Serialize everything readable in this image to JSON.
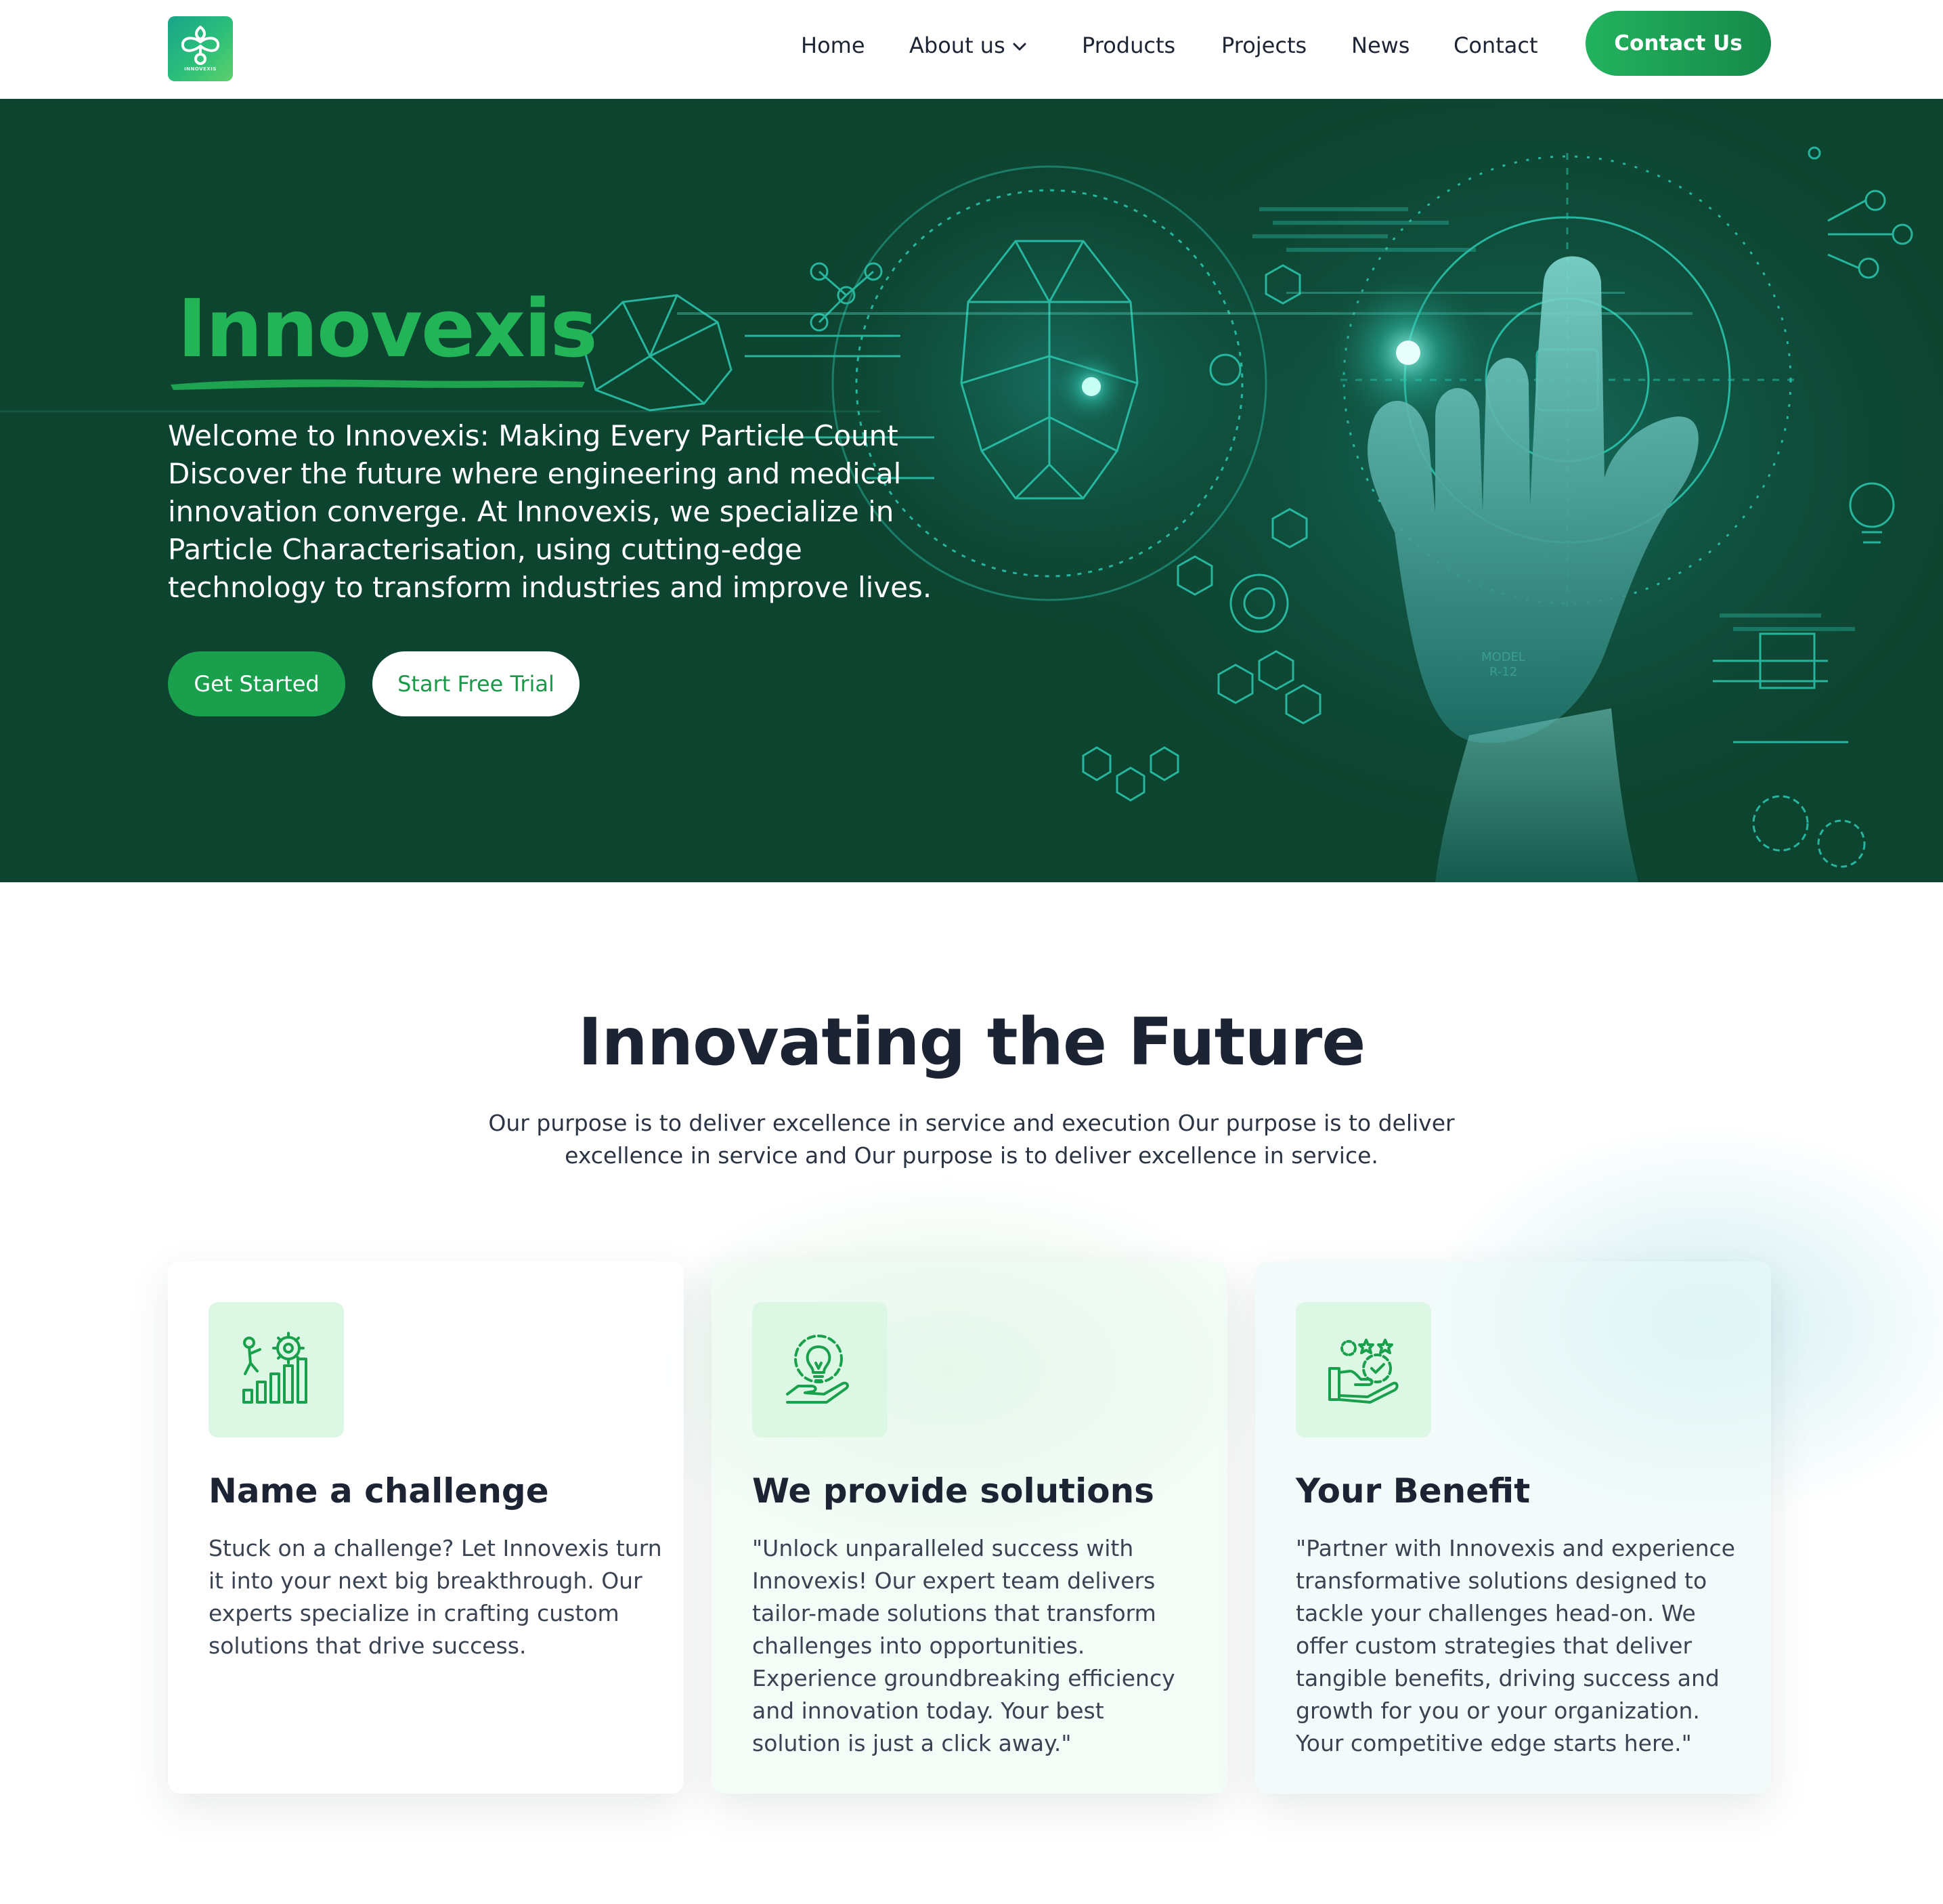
{
  "brand": {
    "name": "Innovexis",
    "logo_text": "INNOVEXIS"
  },
  "nav": {
    "items": [
      "Home",
      "About us",
      "Products",
      "Projects",
      "News",
      "Contact"
    ],
    "cta": "Contact Us"
  },
  "hero": {
    "title": "Innovexis",
    "lines": [
      "Welcome to Innovexis: Making Every Particle Count",
      "Discover the future where engineering and medical",
      "innovation converge. At Innovexis, we specialize in",
      "Particle Characterisation, using cutting-edge",
      "technology to transform industries and improve lives."
    ],
    "primary_button": "Get Started",
    "secondary_button": "Start Free Trial"
  },
  "features": {
    "title": "Innovating the Future",
    "subtitle_lines": [
      "Our purpose is to deliver excellence in service and execution Our purpose is to deliver",
      "excellence in service and Our purpose is to deliver excellence in service."
    ],
    "cards": [
      {
        "icon": "growth-chart-gear-icon",
        "title": "Name a challenge",
        "lines": [
          "Stuck on a challenge? Let Innovexis turn",
          "it into your next big breakthrough. Our",
          "experts specialize in crafting custom",
          "solutions that drive success."
        ]
      },
      {
        "icon": "lightbulb-gear-hand-icon",
        "title": "We provide solutions",
        "lines": [
          "\"Unlock unparalleled success with",
          "Innovexis! Our expert team delivers",
          "tailor-made solutions that transform",
          "challenges into opportunities.",
          "Experience groundbreaking efficiency",
          "and innovation today. Your best",
          "solution is just a click away.\""
        ]
      },
      {
        "icon": "hand-badge-stars-icon",
        "title": "Your Benefit",
        "lines": [
          "\"Partner with Innovexis and experience",
          "transformative solutions designed to",
          "tackle your challenges head-on. We",
          "offer custom strategies that deliver",
          "tangible benefits, driving success and",
          "growth for you or your organization.",
          "Your competitive edge starts here.\""
        ]
      }
    ]
  },
  "colors": {
    "brand_green": "#22b457",
    "hero_bg": "#0d4430",
    "button_green": "#1aa04c",
    "heading": "#1c2434"
  }
}
